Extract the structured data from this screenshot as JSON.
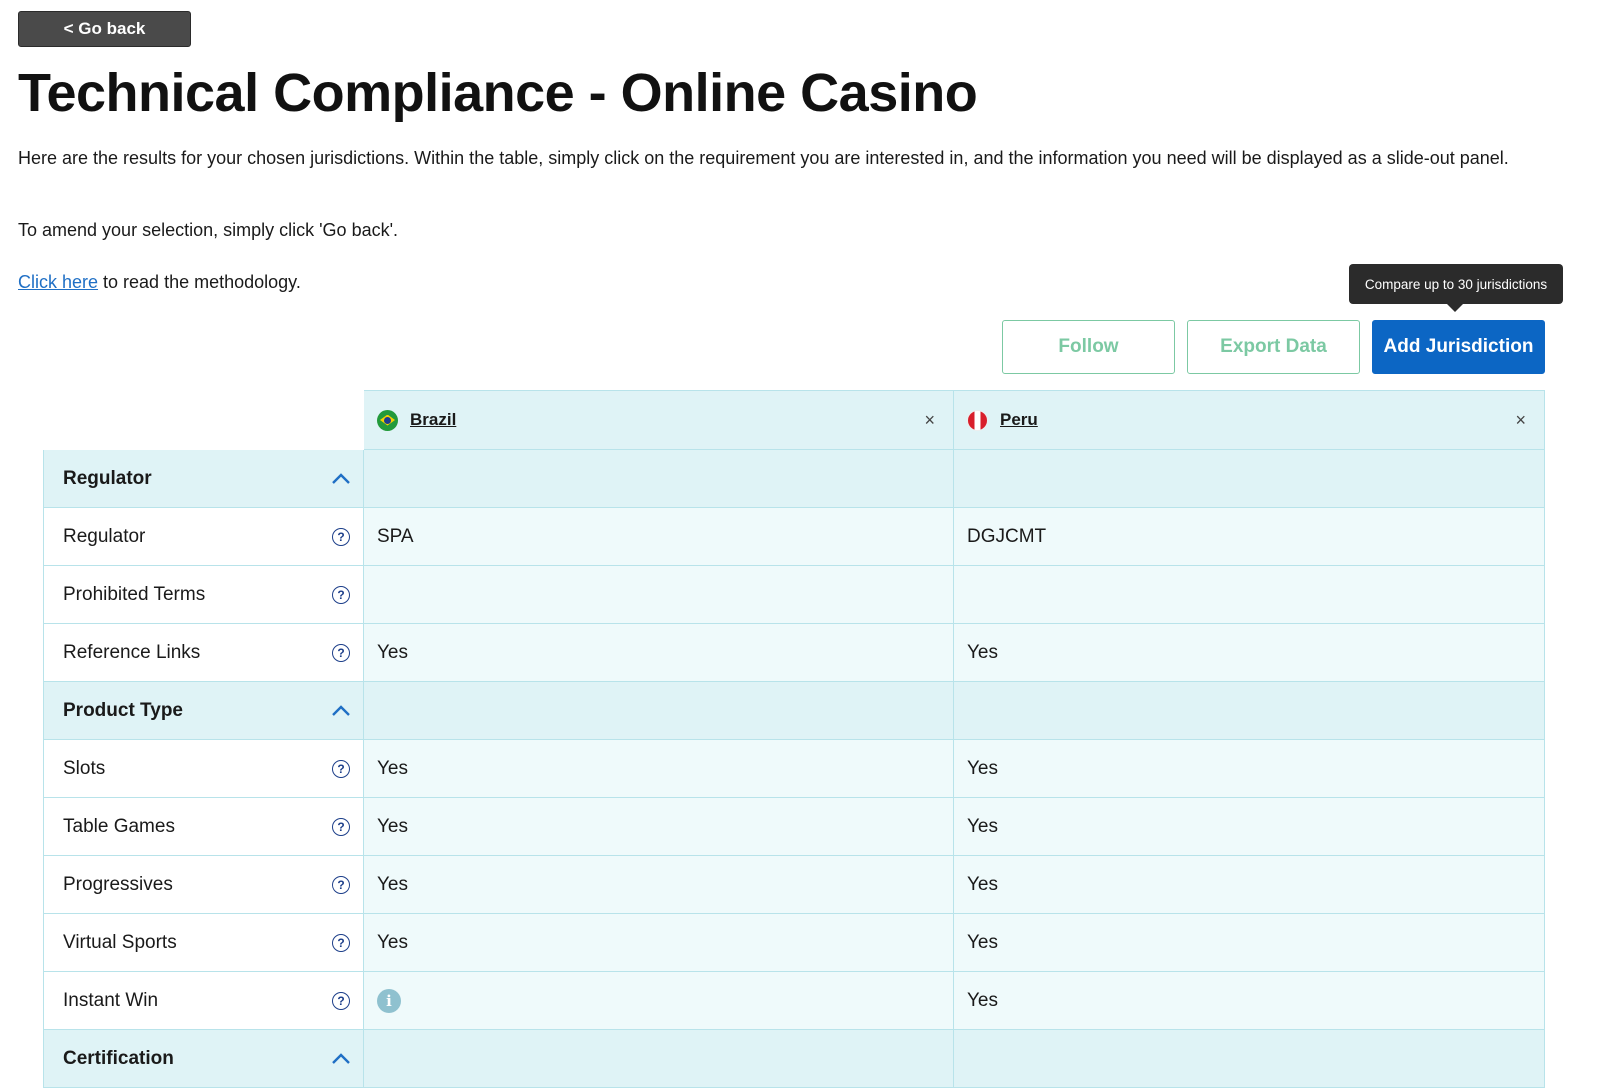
{
  "header": {
    "go_back_label": "< Go back",
    "title": "Technical Compliance - Online Casino",
    "intro": "Here are the results for your chosen jurisdictions. Within the table, simply click on the requirement you are interested in, and the information you need will be displayed as a slide-out panel.",
    "amend_text": "To amend your selection, simply click 'Go back'.",
    "method_link": "Click here",
    "method_rest": " to read the methodology."
  },
  "toolbar": {
    "tooltip": "Compare up to 30 jurisdictions",
    "follow_label": "Follow",
    "export_label": "Export Data",
    "add_label": "Add Jurisdiction"
  },
  "jurisdictions": [
    {
      "name": "Brazil",
      "flag": "brazil-flag-icon"
    },
    {
      "name": "Peru",
      "flag": "peru-flag-icon"
    }
  ],
  "close_glyph": "×",
  "sections": [
    {
      "title": "Regulator",
      "rows": [
        {
          "label": "Regulator",
          "values": [
            "SPA",
            "DGJCMT"
          ]
        },
        {
          "label": "Prohibited Terms",
          "values": [
            "",
            ""
          ]
        },
        {
          "label": "Reference Links",
          "values": [
            "Yes",
            "Yes"
          ]
        }
      ]
    },
    {
      "title": "Product Type",
      "rows": [
        {
          "label": "Slots",
          "values": [
            "Yes",
            "Yes"
          ]
        },
        {
          "label": "Table Games",
          "values": [
            "Yes",
            "Yes"
          ]
        },
        {
          "label": "Progressives",
          "values": [
            "Yes",
            "Yes"
          ]
        },
        {
          "label": "Virtual Sports",
          "values": [
            "Yes",
            "Yes"
          ]
        },
        {
          "label": "Instant Win",
          "values": [
            "",
            "Yes"
          ],
          "info_icon_col": 0
        }
      ]
    },
    {
      "title": "Certification",
      "rows": []
    }
  ],
  "colors": {
    "primary": "#0c66c4",
    "outline_green": "#7cc9a3",
    "header_bg": "#dff3f6",
    "cell_bg": "#effafb"
  }
}
